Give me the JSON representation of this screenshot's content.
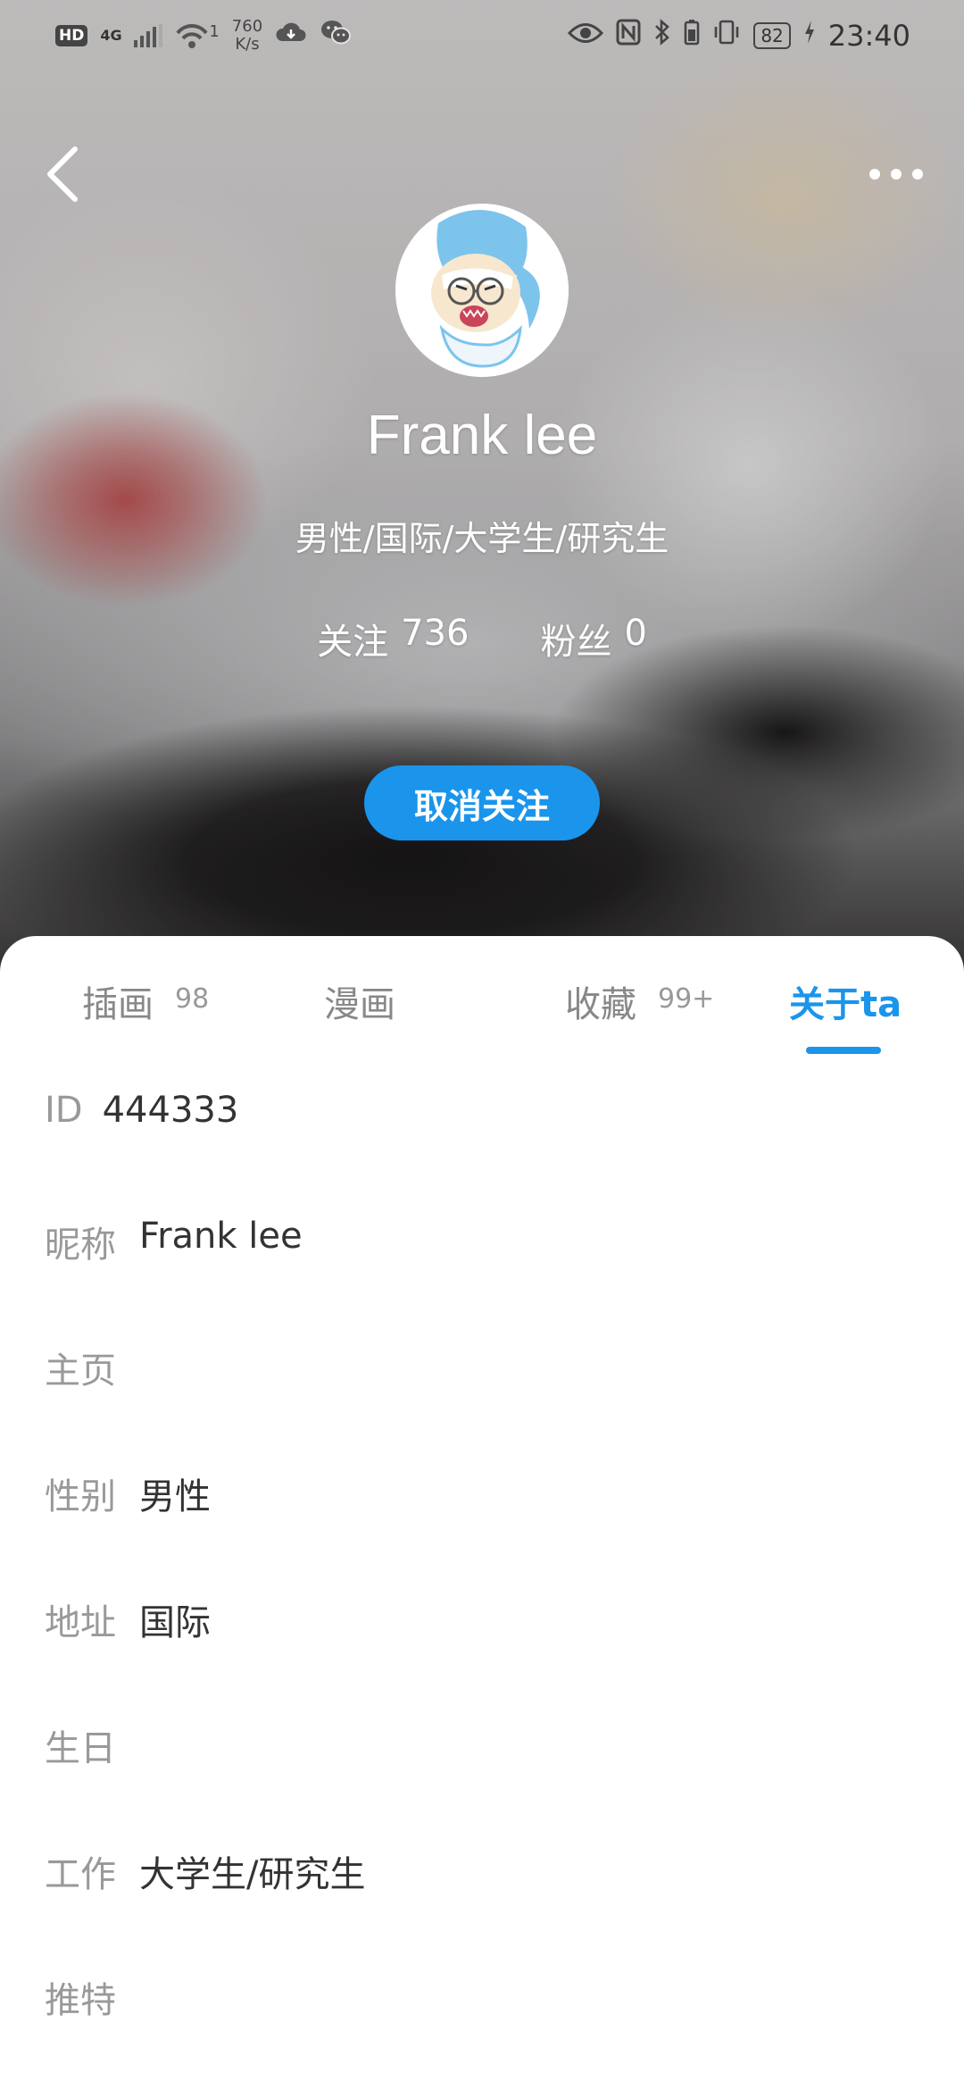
{
  "status_bar": {
    "hd": "HD",
    "network": "4G",
    "wifi_count": "1",
    "speed_value": "760",
    "speed_unit": "K/s",
    "battery": "82",
    "time": "23:40"
  },
  "profile": {
    "name": "Frank lee",
    "tags": "男性/国际/大学生/研究生",
    "following_label": "关注",
    "following_count": "736",
    "followers_label": "粉丝",
    "followers_count": "0",
    "unfollow_label": "取消关注"
  },
  "tabs": [
    {
      "label": "插画",
      "count": "98"
    },
    {
      "label": "漫画",
      "count": ""
    },
    {
      "label": "收藏",
      "count": "99+"
    },
    {
      "label": "关于ta",
      "count": "",
      "active": true
    }
  ],
  "info": [
    {
      "label": "ID",
      "value": "444333"
    },
    {
      "label": "昵称",
      "value": "Frank lee"
    },
    {
      "label": "主页",
      "value": ""
    },
    {
      "label": "性别",
      "value": "男性"
    },
    {
      "label": "地址",
      "value": "国际"
    },
    {
      "label": "生日",
      "value": ""
    },
    {
      "label": "工作",
      "value": "大学生/研究生"
    },
    {
      "label": "推特",
      "value": ""
    }
  ],
  "colors": {
    "accent": "#1a95eb",
    "label_gray": "#999999",
    "value_text": "#333333"
  },
  "icons": {
    "back": "back-arrow-icon",
    "more": "more-dots-icon",
    "avatar": "shark-avatar"
  }
}
